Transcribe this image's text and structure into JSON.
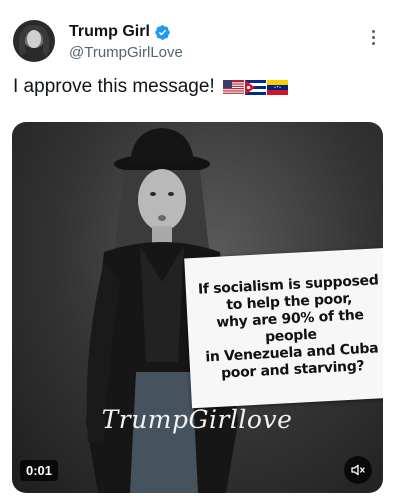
{
  "author": {
    "display_name": "Trump Girl",
    "handle": "@TrumpGirlLove",
    "verified_color": "#1d9bf0"
  },
  "tweet": {
    "text": "I approve this message!",
    "flags": [
      "us-flag-icon",
      "cuba-flag-icon",
      "venezuela-flag-icon"
    ]
  },
  "media": {
    "sign_lines": [
      "If socialism is supposed",
      "to help the poor,",
      "why are 90% of the people",
      "in Venezuela and Cuba",
      "poor and starving?"
    ],
    "watermark": "TrumpGirllove",
    "duration": "0:01",
    "mute_icon": "speaker-muted-icon"
  },
  "colors": {
    "text_primary": "#0f1419",
    "text_secondary": "#536471",
    "accent": "#1d9bf0"
  }
}
